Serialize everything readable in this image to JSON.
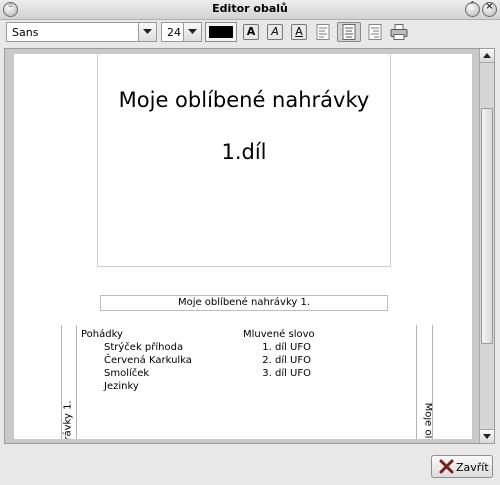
{
  "window": {
    "title": "Editor obalů"
  },
  "toolbar": {
    "font_family": "Sans",
    "font_size": "24",
    "text_color": "#000000",
    "buttons": {
      "bold": "A",
      "italic": "A",
      "underline": "A"
    },
    "alignment_selected": "center"
  },
  "cover": {
    "front": {
      "line1": "Moje oblíbené nahrávky",
      "line2": "1.díl"
    },
    "spine": "Moje oblíbené nahrávky 1.",
    "back": {
      "side_left": "rávky 1.",
      "side_right": "Moje ol",
      "columns": [
        {
          "heading": "Pohádky",
          "items": [
            "Strýček příhoda",
            "Červená Karkulka",
            "Smolíček",
            "Jezinky"
          ]
        },
        {
          "heading": "Mluvené slovo",
          "items": [
            "1. díl UFO",
            "2. díl UFO",
            "3. díl UFO"
          ]
        }
      ]
    }
  },
  "footer": {
    "close_label": "Zavřít"
  }
}
